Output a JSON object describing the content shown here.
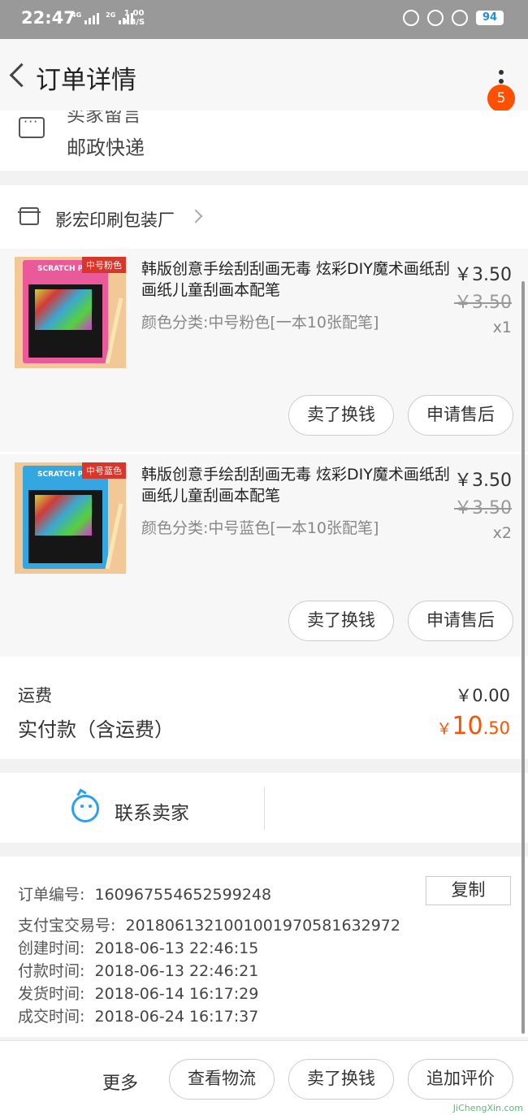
{
  "status_bar": {
    "time": "22:47",
    "net1": "4G",
    "net2": "2G",
    "speed_value": "1.00",
    "speed_unit": "KB/S",
    "battery": "94"
  },
  "header": {
    "title": "订单详情",
    "badge_count": "5"
  },
  "buyer_message": {
    "title": "买家留言",
    "text": "邮政快递"
  },
  "shop": {
    "name": "影宏印刷包装厂"
  },
  "items": [
    {
      "name": "韩版创意手绘刮刮画无毒 炫彩DIY魔术画纸刮画纸儿童刮画本配笔",
      "sku": "颜色分类:中号粉色[一本10张配笔]",
      "price": "￥3.50",
      "original_price": "￥3.50",
      "quantity": "x1",
      "thumb_tag": "中号粉色",
      "thumb_title": "SCRATCH PAPER",
      "sell_label": "卖了换钱",
      "after_sale_label": "申请售后"
    },
    {
      "name": "韩版创意手绘刮刮画无毒 炫彩DIY魔术画纸刮画纸儿童刮画本配笔",
      "sku": "颜色分类:中号蓝色[一本10张配笔]",
      "price": "￥3.50",
      "original_price": "￥3.50",
      "quantity": "x2",
      "thumb_tag": "中号蓝色",
      "thumb_title": "SCRATCH PAPER",
      "sell_label": "卖了换钱",
      "after_sale_label": "申请售后"
    }
  ],
  "fees": {
    "shipping_label": "运费",
    "shipping_value": "￥0.00",
    "paid_label": "实付款（含运费）",
    "paid_currency": "￥",
    "paid_integer": "10",
    "paid_decimal": ".50"
  },
  "contact": {
    "label": "联系卖家"
  },
  "order_info": {
    "copy_label": "复制",
    "rows": [
      {
        "key": "订单编号:",
        "value": "160967554652599248"
      },
      {
        "key": "支付宝交易号:",
        "value": "2018061321001001970581632972"
      },
      {
        "key": "创建时间:",
        "value": "2018-06-13 22:46:15"
      },
      {
        "key": "付款时间:",
        "value": "2018-06-13 22:46:21"
      },
      {
        "key": "发货时间:",
        "value": "2018-06-14 16:17:29"
      },
      {
        "key": "成交时间:",
        "value": "2018-06-24 16:17:37"
      }
    ]
  },
  "bottom_bar": {
    "more_label": "更多",
    "logistics_label": "查看物流",
    "sell_label": "卖了换钱",
    "review_label": "追加评价"
  },
  "watermark": "JiChengXin.com",
  "colors": {
    "accent": "#ff5000",
    "contact_blue": "#29a1f1",
    "status_bar": "#999999"
  }
}
